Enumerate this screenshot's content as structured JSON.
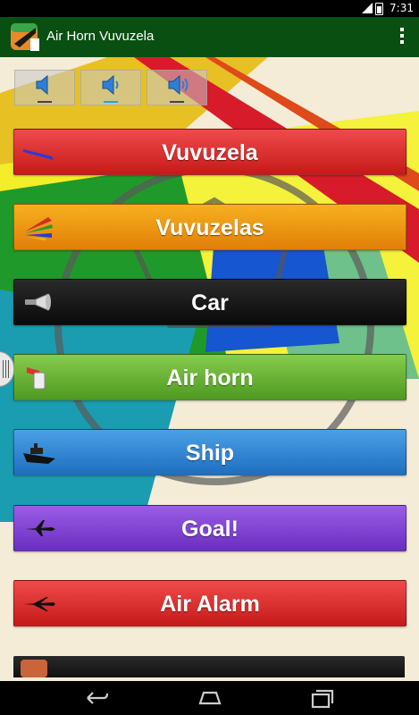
{
  "status_bar": {
    "time": "7:31",
    "network": "3G"
  },
  "action_bar": {
    "title": "Air Horn Vuvuzela"
  },
  "volume_buttons": [
    {
      "name": "volume-low",
      "icon": "speaker-low-icon"
    },
    {
      "name": "volume-medium",
      "icon": "speaker-medium-icon"
    },
    {
      "name": "volume-high",
      "icon": "speaker-high-icon"
    }
  ],
  "sounds": [
    {
      "label": "Vuvuzela",
      "icon": "vuvuzela-icon",
      "color": "#e23030"
    },
    {
      "label": "Vuvuzelas",
      "icon": "vuvuzelas-icon",
      "color": "#f0a010"
    },
    {
      "label": "Car",
      "icon": "car-horn-icon",
      "color": "#111111"
    },
    {
      "label": "Air horn",
      "icon": "air-horn-icon",
      "color": "#6ab43a"
    },
    {
      "label": "Ship",
      "icon": "ship-icon",
      "color": "#3a8ad8"
    },
    {
      "label": "Goal!",
      "icon": "airplane-icon",
      "color": "#8446d6"
    },
    {
      "label": "Air Alarm",
      "icon": "bomber-plane-icon",
      "color": "#e23030"
    }
  ],
  "nav_bar": {
    "back": "back-icon",
    "home": "home-icon",
    "recents": "recents-icon"
  }
}
